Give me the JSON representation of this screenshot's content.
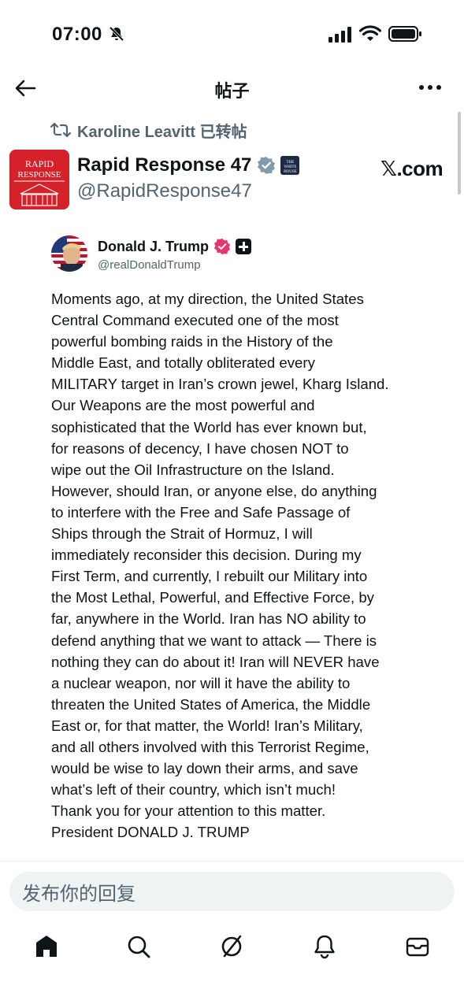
{
  "status_bar": {
    "time": "07:00",
    "icons": [
      "mute-bell-icon",
      "cellular-signal-icon",
      "wifi-icon",
      "battery-icon"
    ]
  },
  "header": {
    "title": "帖子",
    "back_icon": "arrow-left-icon",
    "more_icon": "more-horizontal-icon"
  },
  "repost": {
    "icon": "retweet-icon",
    "text": "Karoline Leavitt 已转帖"
  },
  "author": {
    "name": "Rapid Response 47",
    "handle": "@RapidResponse47",
    "avatar_text_1": "RAPID",
    "avatar_text_2": "RESPONSE",
    "badge": "gray-verified-badge",
    "affiliation_badge_text": "THE WHITE HOUSE",
    "source_label": "𝕏.com"
  },
  "embedded_post": {
    "name": "Donald J. Trump",
    "handle": "@realDonaldTrump",
    "badge": "pink-verified-badge",
    "plus_badge": "plus-badge-icon",
    "lines": [
      "Moments ago, at my direction, the United States",
      "Central Command executed one of the most",
      "powerful bombing raids in the History of the",
      "Middle East, and totally obliterated every",
      "MILITARY target in Iran’s crown jewel, Kharg Island.",
      "Our Weapons are the most powerful and",
      "sophisticated that the World has ever known but,",
      "for reasons of decency, I have chosen NOT to",
      "wipe out the Oil Infrastructure on the Island.",
      "However, should Iran, or anyone else, do anything",
      "to interfere with the Free and Safe Passage of",
      "Ships through the Strait of Hormuz, I will",
      "immediately reconsider this decision. During my",
      "First Term, and currently, I rebuilt our Military into",
      "the Most Lethal, Powerful, and Effective Force, by",
      "far, anywhere in the World. Iran has NO ability to",
      "defend anything that we want to attack — There is",
      "nothing they can do about it! Iran will NEVER have",
      "a nuclear weapon, nor will it have the ability to",
      "threaten the United States of America, the Middle",
      "East or, for that matter, the World! Iran’s Military,",
      "and all others involved with this Terrorist Regime,",
      "would be wise to lay down their arms, and save",
      "what’s left of their country, which isn’t much!",
      "Thank you for your attention to this matter.",
      "President DONALD J. TRUMP"
    ]
  },
  "reply": {
    "placeholder": "发布你的回复"
  },
  "tab_bar": {
    "tabs": [
      "home-icon",
      "search-icon",
      "grok-icon",
      "notifications-bell-icon",
      "messages-envelope-icon"
    ]
  },
  "colors": {
    "text_primary": "#0f1419",
    "text_secondary": "#536471",
    "avatar_red": "#d4212a",
    "pink_badge": "#e8356d",
    "gray_badge": "#829aab",
    "input_bg": "#eff3f4"
  }
}
